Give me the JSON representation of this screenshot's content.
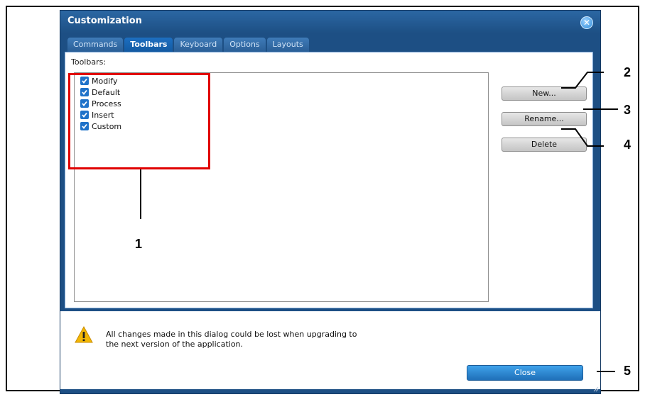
{
  "window": {
    "title": "Customization"
  },
  "tabs": [
    "Commands",
    "Toolbars",
    "Keyboard",
    "Options",
    "Layouts"
  ],
  "panel": {
    "label": "Toolbars:",
    "items": [
      "Modify",
      "Default",
      "Process",
      "Insert",
      "Custom"
    ]
  },
  "buttons": {
    "new": "New...",
    "rename": "Rename...",
    "delete": "Delete"
  },
  "warning": {
    "line1": "All changes made in this dialog could be lost when upgrading to",
    "line2": "the next version of the application."
  },
  "close_label": "Close",
  "callouts": [
    "1",
    "2",
    "3",
    "4",
    "5"
  ],
  "colors": {
    "accent": "#1f72c9",
    "annotation": "#e00000"
  }
}
